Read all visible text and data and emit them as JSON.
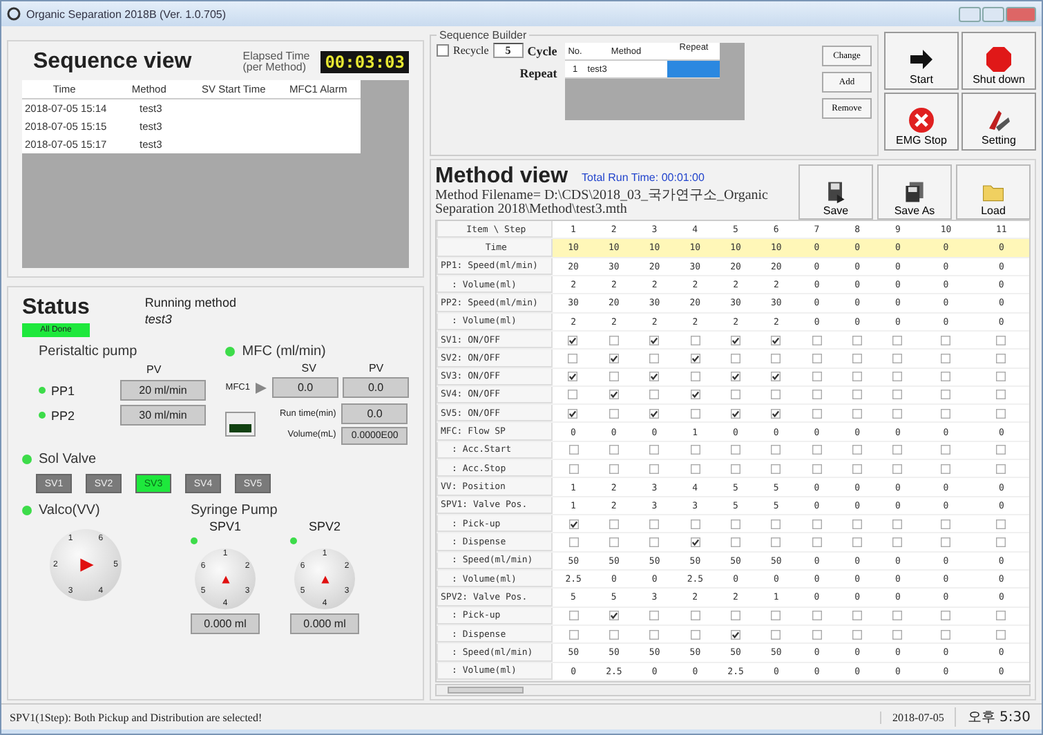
{
  "window": {
    "title": "Organic Separation 2018B (Ver. 1.0.705)"
  },
  "sequence_view": {
    "title": "Sequence view",
    "elapsed_label": "Elapsed Time\n(per Method)",
    "elapsed": "00:03:03",
    "columns": [
      "Time",
      "Method",
      "SV Start Time",
      "MFC1 Alarm"
    ],
    "rows": [
      [
        "2018-07-05 15:14",
        "test3",
        "",
        ""
      ],
      [
        "2018-07-05 15:15",
        "test3",
        "",
        ""
      ],
      [
        "2018-07-05 15:17",
        "test3",
        "",
        ""
      ]
    ]
  },
  "status": {
    "title": "Status",
    "badge": "All Done",
    "running_label": "Running method",
    "running_method": "test3",
    "peristaltic": {
      "title": "Peristaltic pump",
      "pv_label": "PV",
      "pumps": [
        {
          "name": "PP1",
          "on": true,
          "pv": "20 ml/min"
        },
        {
          "name": "PP2",
          "on": true,
          "pv": "30 ml/min"
        }
      ]
    },
    "mfc": {
      "title": "MFC (ml/min)",
      "on": true,
      "sv_label": "SV",
      "pv_label": "PV",
      "name": "MFC1",
      "sv": "0.0",
      "pv": "0.0",
      "runtime_label": "Run time(min)",
      "runtime": "0.0",
      "volume_label": "Volume(mL)",
      "volume": "0.0000E00"
    },
    "sol_valve": {
      "title": "Sol Valve",
      "on": true,
      "valves": [
        {
          "label": "SV1",
          "on": false
        },
        {
          "label": "SV2",
          "on": false
        },
        {
          "label": "SV3",
          "on": true
        },
        {
          "label": "SV4",
          "on": false
        },
        {
          "label": "SV5",
          "on": false
        }
      ]
    },
    "valco": {
      "title": "Valco(VV)",
      "on": true,
      "ports": [
        "1",
        "6",
        "5",
        "4",
        "3",
        "2"
      ]
    },
    "syringe": {
      "title": "Syringe Pump",
      "pumps": [
        {
          "name": "SPV1",
          "on": true,
          "ports": [
            "1",
            "2",
            "3",
            "4",
            "5",
            "6"
          ],
          "volume": "0.000 ml"
        },
        {
          "name": "SPV2",
          "on": true,
          "ports": [
            "1",
            "2",
            "3",
            "4",
            "5",
            "6"
          ],
          "volume": "0.000 ml"
        }
      ]
    }
  },
  "sequence_builder": {
    "title": "Sequence Builder",
    "recycle_label": "Recycle",
    "recycle_checked": false,
    "cycles": "5",
    "cycle_label": "Cycle",
    "repeat_label": "Repeat",
    "columns": [
      "No.",
      "Method",
      "Repeat"
    ],
    "rows": [
      {
        "no": "1",
        "method": "test3",
        "repeat_selected": true
      }
    ],
    "buttons": [
      "Change",
      "Add",
      "Remove"
    ]
  },
  "actions": [
    {
      "label": "Start",
      "kind": "start"
    },
    {
      "label": "Shut down",
      "kind": "shutdown"
    },
    {
      "label": "EMG Stop",
      "kind": "emg"
    },
    {
      "label": "Setting",
      "kind": "setting"
    }
  ],
  "method_view": {
    "title": "Method view",
    "total_run_time": "Total Run Time: 00:01:00",
    "filename": "Method Filename= D:\\CDS\\2018_03_국가연구소_Organic Separation 2018\\Method\\test3.mth",
    "buttons": [
      {
        "label": "Save",
        "kind": "save"
      },
      {
        "label": "Save As",
        "kind": "saveas"
      },
      {
        "label": "Load",
        "kind": "load"
      }
    ],
    "columns": [
      "Item \\ Step",
      "1",
      "2",
      "3",
      "4",
      "5",
      "6",
      "7",
      "8",
      "9",
      "10",
      "11"
    ],
    "rows": [
      {
        "label": "Time",
        "kind": "time",
        "values": [
          "10",
          "10",
          "10",
          "10",
          "10",
          "10",
          "0",
          "0",
          "0",
          "0",
          "0"
        ]
      },
      {
        "label": "PP1: Speed(ml/min)",
        "kind": "value",
        "values": [
          "20",
          "30",
          "20",
          "30",
          "20",
          "20",
          "0",
          "0",
          "0",
          "0",
          "0"
        ]
      },
      {
        "label": ": Volume(ml)",
        "kind": "value",
        "values": [
          "2",
          "2",
          "2",
          "2",
          "2",
          "2",
          "0",
          "0",
          "0",
          "0",
          "0"
        ]
      },
      {
        "label": "PP2: Speed(ml/min)",
        "kind": "value",
        "values": [
          "30",
          "20",
          "30",
          "20",
          "30",
          "30",
          "0",
          "0",
          "0",
          "0",
          "0"
        ]
      },
      {
        "label": ": Volume(ml)",
        "kind": "value",
        "values": [
          "2",
          "2",
          "2",
          "2",
          "2",
          "2",
          "0",
          "0",
          "0",
          "0",
          "0"
        ]
      },
      {
        "label": "SV1: ON/OFF",
        "kind": "check",
        "checks": [
          true,
          false,
          true,
          false,
          true,
          true,
          false,
          false,
          false,
          false,
          false
        ]
      },
      {
        "label": "SV2: ON/OFF",
        "kind": "check",
        "checks": [
          false,
          true,
          false,
          true,
          false,
          false,
          false,
          false,
          false,
          false,
          false
        ]
      },
      {
        "label": "SV3: ON/OFF",
        "kind": "check",
        "checks": [
          true,
          false,
          true,
          false,
          true,
          true,
          false,
          false,
          false,
          false,
          false
        ]
      },
      {
        "label": "SV4: ON/OFF",
        "kind": "check",
        "checks": [
          false,
          true,
          false,
          true,
          false,
          false,
          false,
          false,
          false,
          false,
          false
        ]
      },
      {
        "label": "SV5: ON/OFF",
        "kind": "check",
        "checks": [
          true,
          false,
          true,
          false,
          true,
          true,
          false,
          false,
          false,
          false,
          false
        ]
      },
      {
        "label": "MFC: Flow SP",
        "kind": "value",
        "values": [
          "0",
          "0",
          "0",
          "1",
          "0",
          "0",
          "0",
          "0",
          "0",
          "0",
          "0"
        ]
      },
      {
        "label": ": Acc.Start",
        "kind": "check",
        "checks": [
          false,
          false,
          false,
          false,
          false,
          false,
          false,
          false,
          false,
          false,
          false
        ]
      },
      {
        "label": ": Acc.Stop",
        "kind": "check",
        "checks": [
          false,
          false,
          false,
          false,
          false,
          false,
          false,
          false,
          false,
          false,
          false
        ]
      },
      {
        "label": "VV: Position",
        "kind": "value",
        "values": [
          "1",
          "2",
          "3",
          "4",
          "5",
          "5",
          "0",
          "0",
          "0",
          "0",
          "0"
        ]
      },
      {
        "label": "SPV1: Valve Pos.",
        "kind": "value",
        "values": [
          "1",
          "2",
          "3",
          "3",
          "5",
          "5",
          "0",
          "0",
          "0",
          "0",
          "0"
        ]
      },
      {
        "label": ": Pick-up",
        "kind": "check",
        "checks": [
          true,
          false,
          false,
          false,
          false,
          false,
          false,
          false,
          false,
          false,
          false
        ]
      },
      {
        "label": ": Dispense",
        "kind": "check",
        "checks": [
          false,
          false,
          false,
          true,
          false,
          false,
          false,
          false,
          false,
          false,
          false
        ]
      },
      {
        "label": ": Speed(ml/min)",
        "kind": "value",
        "values": [
          "50",
          "50",
          "50",
          "50",
          "50",
          "50",
          "0",
          "0",
          "0",
          "0",
          "0"
        ]
      },
      {
        "label": ": Volume(ml)",
        "kind": "value",
        "values": [
          "2.5",
          "0",
          "0",
          "2.5",
          "0",
          "0",
          "0",
          "0",
          "0",
          "0",
          "0"
        ]
      },
      {
        "label": "SPV2: Valve Pos.",
        "kind": "value",
        "values": [
          "5",
          "5",
          "3",
          "2",
          "2",
          "1",
          "0",
          "0",
          "0",
          "0",
          "0"
        ]
      },
      {
        "label": ": Pick-up",
        "kind": "check",
        "checks": [
          false,
          true,
          false,
          false,
          false,
          false,
          false,
          false,
          false,
          false,
          false
        ]
      },
      {
        "label": ": Dispense",
        "kind": "check",
        "checks": [
          false,
          false,
          false,
          false,
          true,
          false,
          false,
          false,
          false,
          false,
          false
        ]
      },
      {
        "label": ": Speed(ml/min)",
        "kind": "value",
        "values": [
          "50",
          "50",
          "50",
          "50",
          "50",
          "50",
          "0",
          "0",
          "0",
          "0",
          "0"
        ]
      },
      {
        "label": ": Volume(ml)",
        "kind": "value",
        "values": [
          "0",
          "2.5",
          "0",
          "0",
          "2.5",
          "0",
          "0",
          "0",
          "0",
          "0",
          "0"
        ]
      }
    ]
  },
  "status_bar": {
    "message": "SPV1(1Step): Both Pickup and Distribution are selected!",
    "date": "2018-07-05",
    "time": "오후 5:30"
  }
}
